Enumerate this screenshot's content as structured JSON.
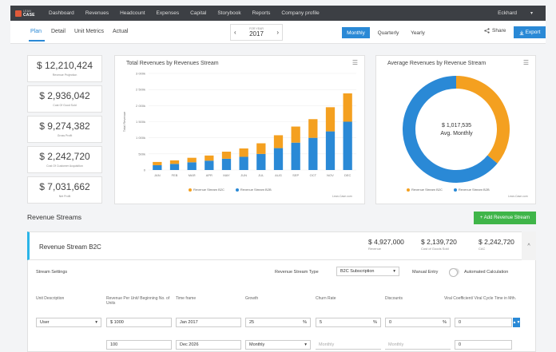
{
  "brand": {
    "line1": "LEAN",
    "line2": "CASE"
  },
  "nav": {
    "items": [
      "Dashboard",
      "Revenues",
      "Headcount",
      "Expenses",
      "Capital",
      "Storybook",
      "Reports",
      "Company profile"
    ],
    "user": "Eckhard",
    "caret": "▾"
  },
  "subnav": {
    "tabs": [
      "Plan",
      "Detail",
      "Unit Metrics",
      "Actual"
    ],
    "active_tab": "Plan",
    "year_label": "FOR YEAR",
    "year": "2017",
    "periods": [
      "Monthly",
      "Quarterly",
      "Yearly"
    ],
    "active_period": "Monthly",
    "share_label": "Share",
    "export_label": "Export"
  },
  "kpis": [
    {
      "value": "$ 12,210,424",
      "label": "Revenue Projection"
    },
    {
      "value": "$ 2,936,042",
      "label": "Cost Of Good Sold"
    },
    {
      "value": "$ 9,274,382",
      "label": "Gross Profit"
    },
    {
      "value": "$ 2,242,720",
      "label": "Cost Of Customer Acquisition"
    },
    {
      "value": "$ 7,031,662",
      "label": "Net Profit"
    }
  ],
  "bar_chart": {
    "title": "Total Revenues by Revenues Stream",
    "credit": "Lean-Case.com",
    "legend": [
      "Revenue Stream B2C",
      "Revenue Stream B2B"
    ]
  },
  "donut_chart": {
    "title": "Average Revenues by Revenue Stream",
    "center_value": "$ 1,017,535",
    "center_label": "Avg. Monthly",
    "credit": "Lean-Case.com",
    "legend": [
      "Revenue Stream B2C",
      "Revenue Stream B2B"
    ]
  },
  "chart_data": [
    {
      "type": "bar",
      "stacked": true,
      "title": "Total Revenues by Revenues Stream",
      "ylabel": "Total Revenue",
      "xlabel": "",
      "categories": [
        "JAN",
        "FEB",
        "MAR",
        "APR",
        "MAY",
        "JUN",
        "JUL",
        "AUG",
        "SEP",
        "OCT",
        "NOV",
        "DEC"
      ],
      "yticks": [
        "0",
        "500k",
        "1 000k",
        "1 500k",
        "2 000k",
        "2 500k",
        "3 000k"
      ],
      "ylim": [
        0,
        3000000
      ],
      "series": [
        {
          "name": "Revenue Stream B2B",
          "color": "#2a89d6",
          "values": [
            150000,
            190000,
            240000,
            290000,
            350000,
            410000,
            500000,
            680000,
            850000,
            1000000,
            1200000,
            1500000
          ]
        },
        {
          "name": "Revenue Stream B2C",
          "color": "#f4a020",
          "values": [
            100000,
            110000,
            140000,
            160000,
            220000,
            260000,
            330000,
            400000,
            500000,
            580000,
            750000,
            880000
          ]
        }
      ],
      "legend": "bottom",
      "grid": true
    },
    {
      "type": "pie",
      "donut": true,
      "title": "Average Revenues by Revenue Stream",
      "labels": [
        "Revenue Stream B2C",
        "Revenue Stream B2B"
      ],
      "values": [
        36,
        64
      ],
      "colors": [
        "#f4a020",
        "#2a89d6"
      ],
      "center_text": "$ 1,017,535",
      "legend": "bottom"
    }
  ],
  "revenue_streams": {
    "title": "Revenue Streams",
    "add_label": "+ Add Revenue Stream",
    "stream": {
      "name": "Revenue Stream B2C",
      "revenue": "$ 4,927,000",
      "revenue_label": "Revenue",
      "cogs": "$ 2,139,720",
      "cogs_label": "Cost of Goods Sold",
      "cac": "$ 2,242,720",
      "cac_label": "CAC",
      "collapse": "^"
    },
    "settings": {
      "title": "Stream Settings",
      "type_label": "Revenue Stream Type",
      "type_value": "B2C Subscription",
      "manual_entry": "Manual Entry",
      "automated": "Automated Calculation",
      "columns": [
        "Unit Description",
        "Revenue Per Unit/ Beginning No. of Units",
        "Time frame",
        "Growth",
        "Churn Rate",
        "Discounts",
        "Viral Coefficient/ Viral Cycle Time in Mth."
      ],
      "row1": {
        "unit": "User",
        "price": "$ 1000",
        "time": "Jan 2017",
        "growth": "25",
        "growth_unit": "%",
        "churn": "5",
        "churn_unit": "%",
        "discount": "0",
        "discount_unit": "%",
        "viral": "0"
      },
      "row2": {
        "units": "100",
        "time": "Dec 2026",
        "growth_period": "Monthly",
        "churn_period": "Monthly",
        "discount_period": "Monthly",
        "viral": "0"
      },
      "spinner": "▲▼"
    }
  }
}
